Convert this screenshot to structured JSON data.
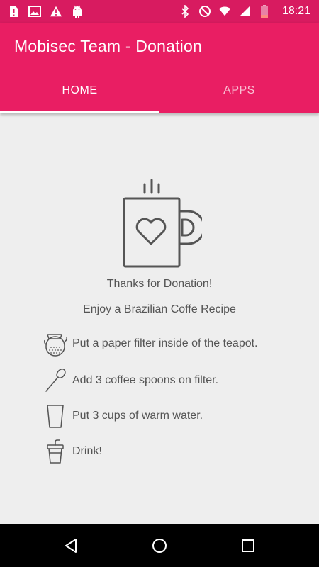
{
  "status_bar": {
    "time": "18:21",
    "left_icons": [
      "sim-alert-icon",
      "image-icon",
      "warning-icon",
      "android-icon"
    ],
    "right_icons": [
      "bluetooth-icon",
      "do-not-disturb-icon",
      "wifi-icon",
      "signal-icon",
      "battery-low-icon"
    ],
    "color": "#d81b60"
  },
  "app_bar": {
    "title": "Mobisec Team - Donation",
    "color": "#e91e63"
  },
  "tabs": [
    {
      "label": "HOME",
      "active": true
    },
    {
      "label": "APPS",
      "active": false
    }
  ],
  "main": {
    "hero_icon": "coffee-mug-heart-icon",
    "thanks_text": "Thanks for Donation!",
    "recipe_title": "Enjoy a Brazilian Coffe Recipe",
    "steps": [
      {
        "icon": "teapot-icon",
        "text": "Put a paper filter inside of the teapot."
      },
      {
        "icon": "spoon-icon",
        "text": "Add 3 coffee spoons on filter."
      },
      {
        "icon": "glass-icon",
        "text": "Put 3 cups of warm water."
      },
      {
        "icon": "takeaway-cup-icon",
        "text": "Drink!"
      }
    ]
  },
  "nav_bar": {
    "buttons": [
      "back-icon",
      "home-icon",
      "recent-apps-icon"
    ]
  }
}
